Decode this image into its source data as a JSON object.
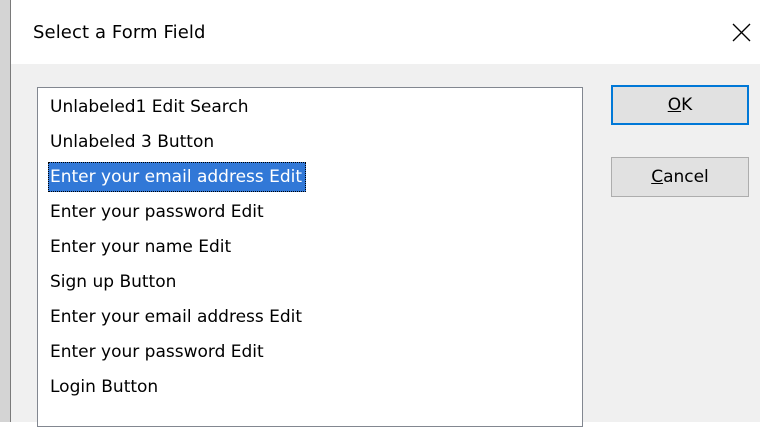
{
  "dialog": {
    "title": "Select a Form Field",
    "close_icon": "close-x-icon"
  },
  "fields": [
    {
      "label": "Unlabeled1 Edit Search",
      "selected": false
    },
    {
      "label": "Unlabeled 3 Button",
      "selected": false
    },
    {
      "label": "Enter your email address Edit",
      "selected": true
    },
    {
      "label": "Enter your password Edit",
      "selected": false
    },
    {
      "label": "Enter your name Edit",
      "selected": false
    },
    {
      "label": "Sign up Button",
      "selected": false
    },
    {
      "label": "Enter your email address Edit",
      "selected": false
    },
    {
      "label": "Enter your password Edit",
      "selected": false
    },
    {
      "label": "Login Button",
      "selected": false
    }
  ],
  "buttons": {
    "ok": {
      "accel": "O",
      "rest": "K"
    },
    "cancel": {
      "accel": "C",
      "rest": "ancel"
    }
  },
  "colors": {
    "selection": "#3178d7",
    "default_button_border": "#0078d7"
  }
}
